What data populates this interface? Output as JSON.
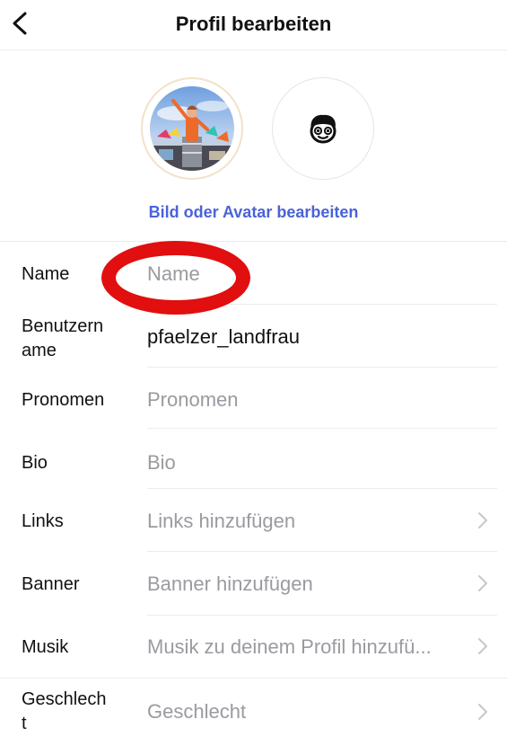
{
  "header": {
    "title": "Profil bearbeiten"
  },
  "photo": {
    "edit_label": "Bild oder Avatar bearbeiten"
  },
  "fields": {
    "name": {
      "label": "Name",
      "placeholder": "Name"
    },
    "username": {
      "label_line1": "Benutzern",
      "label_line2": "ame",
      "value": "pfaelzer_landfrau"
    },
    "pronouns": {
      "label": "Pronomen",
      "placeholder": "Pronomen"
    },
    "bio": {
      "label": "Bio",
      "placeholder": "Bio"
    },
    "links": {
      "label": "Links",
      "placeholder": "Links hinzufügen"
    },
    "banner": {
      "label": "Banner",
      "placeholder": "Banner hinzufügen"
    },
    "music": {
      "label": "Musik",
      "placeholder": "Musik zu deinem Profil hinzufü..."
    },
    "gender": {
      "label_line1": "Geschlech",
      "label_line2": "t",
      "placeholder": "Geschlecht"
    }
  },
  "colors": {
    "accent": "#4a63d8",
    "highlight": "#e10f0f",
    "placeholder": "#9a9aa0"
  },
  "icons": {
    "back": "chevron-left-icon",
    "avatar": "cartoon-face-avatar-icon",
    "row_chevron": "chevron-right-icon"
  }
}
